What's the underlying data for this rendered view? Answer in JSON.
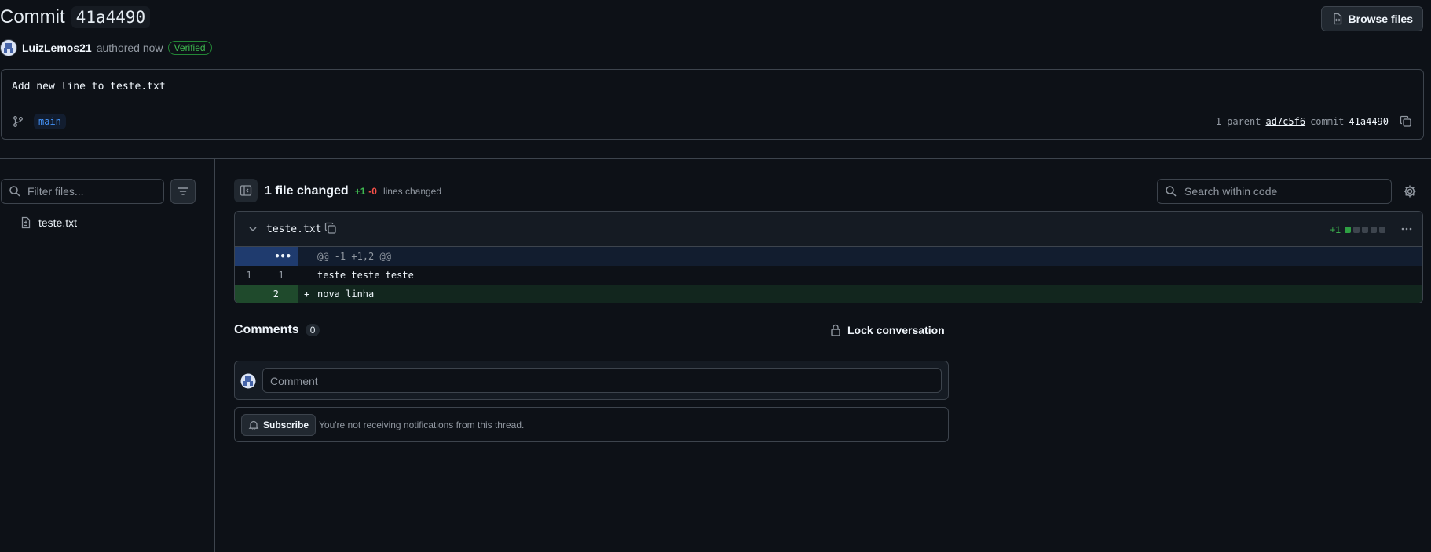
{
  "header": {
    "title_prefix": "Commit",
    "commit_short": "41a4490",
    "browse_files_label": "Browse files",
    "author": "LuizLemos21",
    "authored_text": "authored now",
    "verified_label": "Verified"
  },
  "commit_message": "Add new line to teste.txt",
  "branch": "main",
  "parents": {
    "parent_label": "1 parent",
    "parent_sha": "ad7c5f6",
    "commit_label": "commit",
    "commit_sha": "41a4490"
  },
  "sidebar": {
    "filter_placeholder": "Filter files...",
    "files": [
      {
        "name": "teste.txt"
      }
    ]
  },
  "summary": {
    "files_changed": "1 file changed",
    "additions": "+1",
    "deletions": "-0",
    "lines_changed": "lines changed",
    "search_placeholder": "Search within code"
  },
  "diff": {
    "filename": "teste.txt",
    "stat": "+1",
    "stat_blocks": [
      "added",
      "neutral",
      "neutral",
      "neutral",
      "neutral"
    ],
    "hunk_expand": "•••",
    "hunk_header": "@@ -1 +1,2 @@",
    "context_line": {
      "old": "1",
      "new": "1",
      "text": "teste teste teste"
    },
    "added_line": {
      "new": "2",
      "sign": "+",
      "text": "nova linha"
    }
  },
  "comments": {
    "label": "Comments",
    "count": "0",
    "lock_label": "Lock conversation",
    "comment_placeholder": "Comment",
    "subscribe_label": "Subscribe",
    "subscribe_note": "You're not receiving notifications from this thread."
  },
  "colors": {
    "background": "#0d1117",
    "accent_blue": "#4493f8",
    "added_green": "#3fb950",
    "deleted_red": "#f85149"
  }
}
